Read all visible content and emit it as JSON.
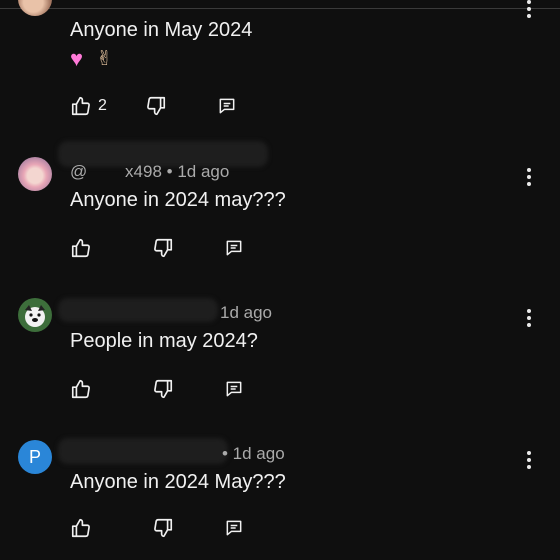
{
  "comments": [
    {
      "handle": "",
      "age": "",
      "text": "Anyone in May 2024",
      "emoji": [
        "heart-emoji",
        "peace-emoji"
      ],
      "likes": "2"
    },
    {
      "handle": "@        x498",
      "age": "• 1d ago",
      "text": "Anyone in 2024 may???",
      "likes": ""
    },
    {
      "handle": "",
      "age": "1d ago",
      "text": "People in may 2024?",
      "likes": ""
    },
    {
      "avatar_letter": "P",
      "handle": "",
      "age": "• 1d ago",
      "text": "Anyone in 2024 May???",
      "likes": ""
    }
  ],
  "colors": {
    "background": "#0f0f0f",
    "text": "#f1f1f1",
    "meta": "#aaaaaa",
    "avatar_p": "#2a86d8"
  },
  "icons": [
    "thumbs-up-icon",
    "thumbs-down-icon",
    "reply-icon",
    "more-vert-icon"
  ]
}
